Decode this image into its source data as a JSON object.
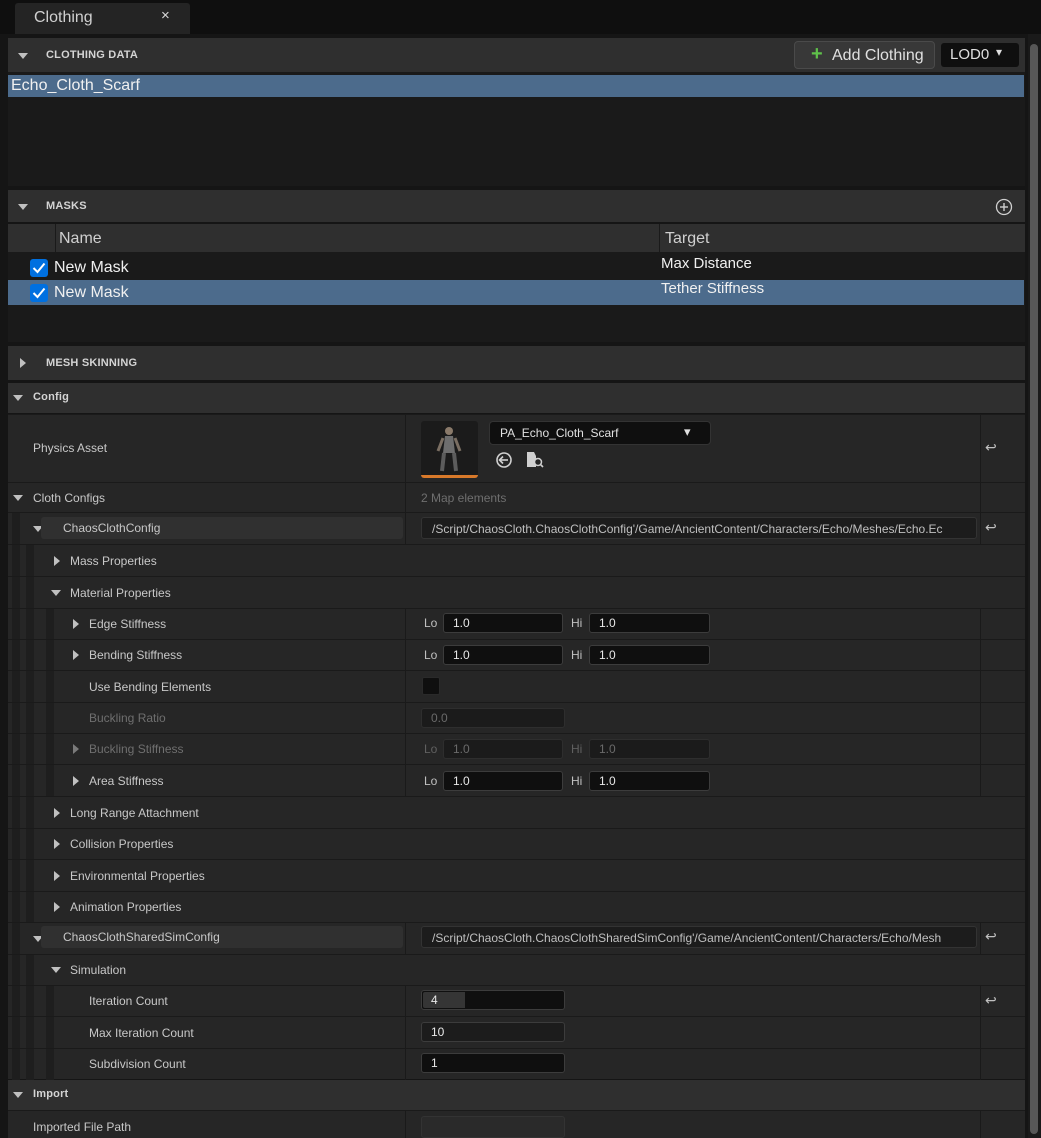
{
  "tab": {
    "title": "Clothing",
    "close": "×"
  },
  "clothing_data": {
    "title": "CLOTHING DATA",
    "add_button": "Add Clothing",
    "lod": "LOD0",
    "items": [
      "Echo_Cloth_Scarf"
    ]
  },
  "masks": {
    "title": "MASKS",
    "columns": {
      "name": "Name",
      "target": "Target"
    },
    "rows": [
      {
        "name": "New Mask",
        "target": "Max Distance",
        "checked": true
      },
      {
        "name": "New Mask",
        "target": "Tether Stiffness",
        "checked": true
      }
    ]
  },
  "mesh_skinning": {
    "title": "MESH SKINNING"
  },
  "config": {
    "title": "Config",
    "physics_asset_label": "Physics Asset",
    "physics_asset_value": "PA_Echo_Cloth_Scarf",
    "cloth_configs_label": "Cloth Configs",
    "cloth_configs_count": "2 Map elements",
    "chaos_cloth_config": {
      "key": "ChaosClothConfig",
      "path": "/Script/ChaosCloth.ChaosClothConfig'/Game/AncientContent/Characters/Echo/Meshes/Echo.Ec",
      "mass_properties": "Mass Properties",
      "material_properties": "Material Properties",
      "edge_stiffness": {
        "label": "Edge Stiffness",
        "lo": "1.0",
        "hi": "1.0"
      },
      "bending_stiffness": {
        "label": "Bending Stiffness",
        "lo": "1.0",
        "hi": "1.0"
      },
      "use_bending_elements": "Use Bending Elements",
      "buckling_ratio": {
        "label": "Buckling Ratio",
        "value": "0.0"
      },
      "buckling_stiffness": {
        "label": "Buckling Stiffness",
        "lo": "1.0",
        "hi": "1.0"
      },
      "area_stiffness": {
        "label": "Area Stiffness",
        "lo": "1.0",
        "hi": "1.0"
      },
      "long_range_attachment": "Long Range Attachment",
      "collision_properties": "Collision Properties",
      "environmental_properties": "Environmental Properties",
      "animation_properties": "Animation Properties"
    },
    "shared_sim_config": {
      "key": "ChaosClothSharedSimConfig",
      "path": "/Script/ChaosCloth.ChaosClothSharedSimConfig'/Game/AncientContent/Characters/Echo/Mesh",
      "simulation": "Simulation",
      "iteration_count": {
        "label": "Iteration Count",
        "value": "4",
        "fill": 0.3
      },
      "max_iteration_count": {
        "label": "Max Iteration Count",
        "value": "10"
      },
      "subdivision_count": {
        "label": "Subdivision Count",
        "value": "1"
      }
    },
    "lo_label": "Lo",
    "hi_label": "Hi"
  },
  "import": {
    "title": "Import",
    "imported_file_path_label": "Imported File Path",
    "imported_file_path_value": ""
  },
  "colors": {
    "selection": "#4c6b8c",
    "add_icon": "#5fc04a",
    "checkbox": "#0070e0",
    "thumbnail_accent": "#d8792a"
  }
}
